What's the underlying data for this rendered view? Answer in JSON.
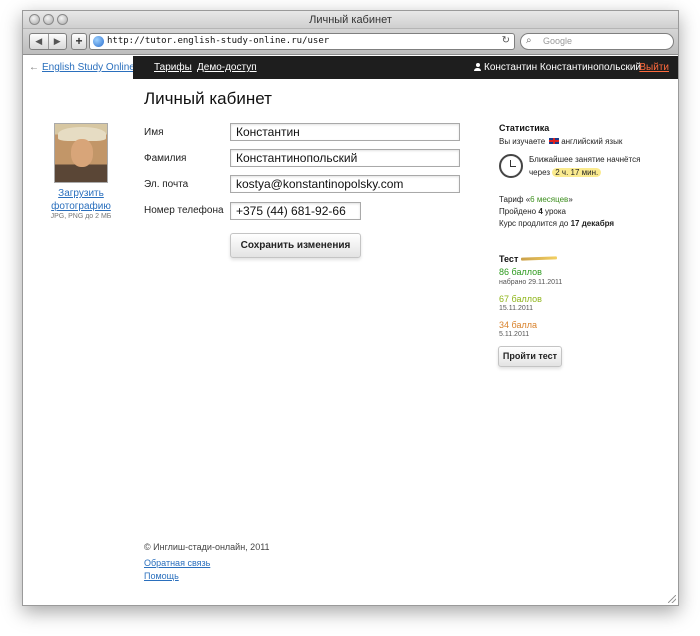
{
  "window": {
    "title": "Личный кабинет"
  },
  "browser": {
    "url": "http://tutor.english-study-online.ru/user",
    "search_placeholder": "Google"
  },
  "sitebar": {
    "back_link": "English Study Online",
    "nav": [
      "Тарифы",
      "Демо-доступ"
    ],
    "user_name": "Константин Константинопольский",
    "logout": "Выйти",
    "logout_color": "#ff6a3d"
  },
  "page": {
    "title": "Личный кабинет"
  },
  "avatar": {
    "upload_line1": "Загрузить",
    "upload_line2": "фотографию",
    "hint": "JPG, PNG до 2 МБ"
  },
  "form": {
    "fields": [
      {
        "label": "Имя",
        "value": "Константин"
      },
      {
        "label": "Фамилия",
        "value": "Константинопольский"
      },
      {
        "label": "Эл. почта",
        "value": "kostya@konstantinopolsky.com"
      },
      {
        "label": "Номер телефона",
        "value": "+375 (44) 681-92-66"
      }
    ],
    "save_label": "Сохранить изменения"
  },
  "stats": {
    "title": "Статистика",
    "studying_prefix": "Вы изучаете",
    "language": "английский язык",
    "next_lesson_line1": "Ближайшее занятие начнётся",
    "next_lesson_prefix": "через",
    "next_lesson_time": "2 ч. 17 мин.",
    "tariff_prefix": "Тариф «",
    "tariff_value": "6 месяцев",
    "tariff_suffix": "»",
    "passed_prefix": "Пройдено",
    "passed_count": "4",
    "passed_suffix": "урока",
    "course_prefix": "Курс продлится до",
    "course_end": "17 декабря",
    "accent_green": "#3d8f1e",
    "highlight_color": "#fbeb8f"
  },
  "tests": {
    "title": "Тест",
    "results": [
      {
        "score": "86 баллов",
        "date": "набрано 29.11.2011",
        "color": "#2d9a1e"
      },
      {
        "score": "67 баллов",
        "date": "15.11.2011",
        "color": "#8fb51a"
      },
      {
        "score": "34 балла",
        "date": "5.11.2011",
        "color": "#d9822b"
      }
    ],
    "button": "Пройти тест"
  },
  "footer": {
    "copyright": "© Инглиш-стади-онлайн, 2011",
    "links": [
      "Обратная связь",
      "Помощь"
    ]
  }
}
